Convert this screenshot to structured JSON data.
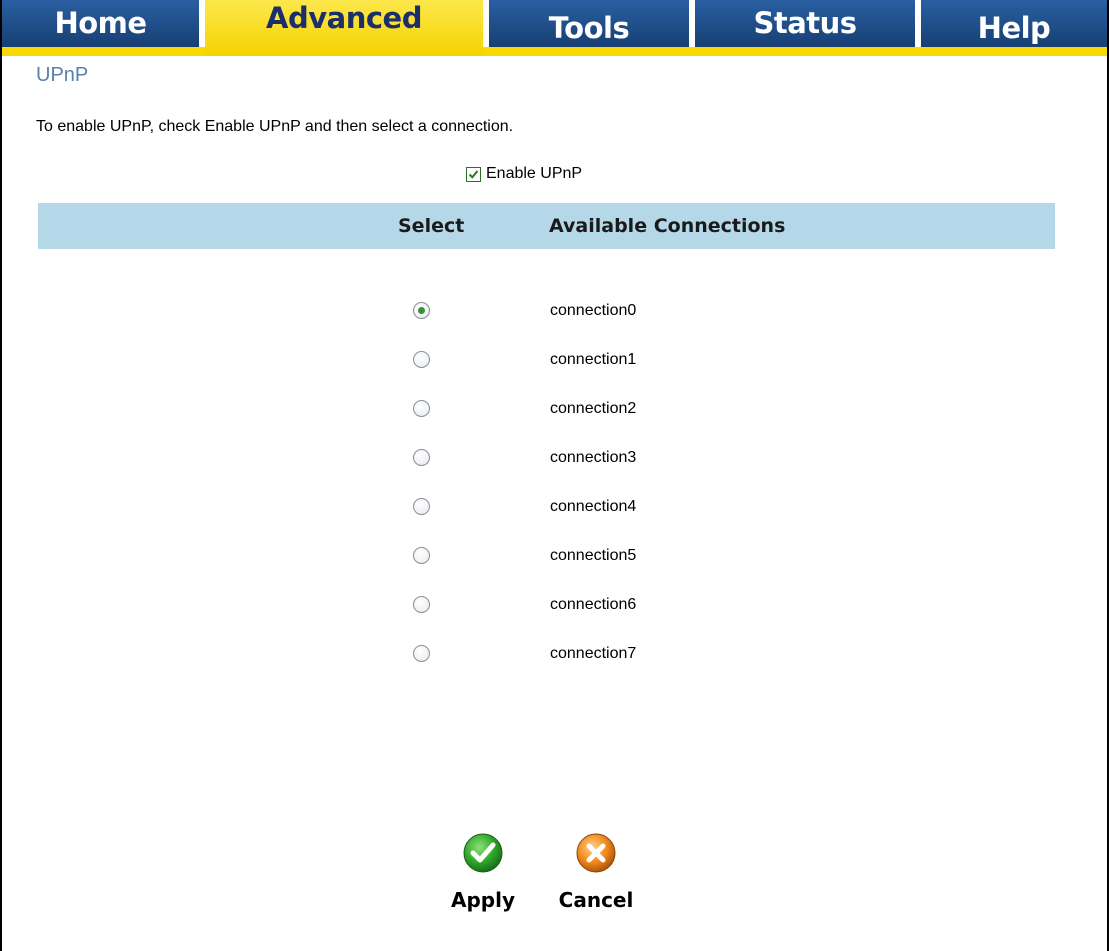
{
  "nav": {
    "tabs": [
      {
        "label": "Home",
        "active": false
      },
      {
        "label": "Advanced",
        "active": true
      },
      {
        "label": "Tools",
        "active": false
      },
      {
        "label": "Status",
        "active": false
      },
      {
        "label": "Help",
        "active": false
      }
    ]
  },
  "page": {
    "title": "UPnP",
    "instructions": "To enable UPnP, check Enable UPnP and then select a connection.",
    "enable_label": "Enable UPnP",
    "enable_checked": true
  },
  "table": {
    "select_header": "Select",
    "connections_header": "Available Connections",
    "rows": [
      {
        "label": "connection0",
        "selected": true
      },
      {
        "label": "connection1",
        "selected": false
      },
      {
        "label": "connection2",
        "selected": false
      },
      {
        "label": "connection3",
        "selected": false
      },
      {
        "label": "connection4",
        "selected": false
      },
      {
        "label": "connection5",
        "selected": false
      },
      {
        "label": "connection6",
        "selected": false
      },
      {
        "label": "connection7",
        "selected": false
      }
    ]
  },
  "buttons": {
    "apply_label": "Apply",
    "cancel_label": "Cancel",
    "apply_icon": "checkmark-icon",
    "cancel_icon": "x-icon"
  },
  "colors": {
    "nav_blue": "#1f4f8e",
    "nav_active": "#fbdf19",
    "header_bg": "#b5d8e8",
    "title": "#5a7fb0"
  }
}
